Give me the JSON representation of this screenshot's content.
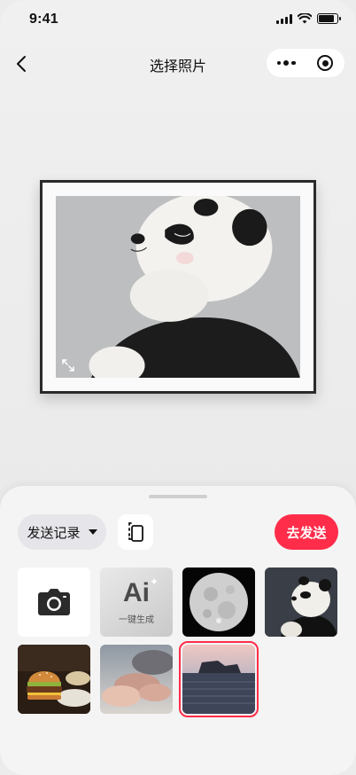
{
  "status_bar": {
    "time": "9:41",
    "battery_level": 0.85
  },
  "nav": {
    "title": "选择照片",
    "back_icon": "chevron-left-icon",
    "more_icon": "more-dots-icon",
    "close_icon": "target-close-icon"
  },
  "preview": {
    "subject": "panda-photo",
    "expand_icon": "expand-icon"
  },
  "sheet": {
    "history_label": "发送记录",
    "copy_icon": "copy-screen-icon",
    "send_label": "去发送"
  },
  "grid": {
    "camera_icon": "camera-icon",
    "ai_logo": "Ai",
    "ai_label": "一键生成",
    "photos": [
      {
        "name": "moon-photo"
      },
      {
        "name": "panda-photo"
      },
      {
        "name": "burger-photo"
      },
      {
        "name": "clouds-photo"
      },
      {
        "name": "sea-rock-photo",
        "selected": true
      }
    ]
  },
  "colors": {
    "accent": "#ff2d4a",
    "background": "#eeeeee",
    "sheet": "#f4f4f4"
  }
}
